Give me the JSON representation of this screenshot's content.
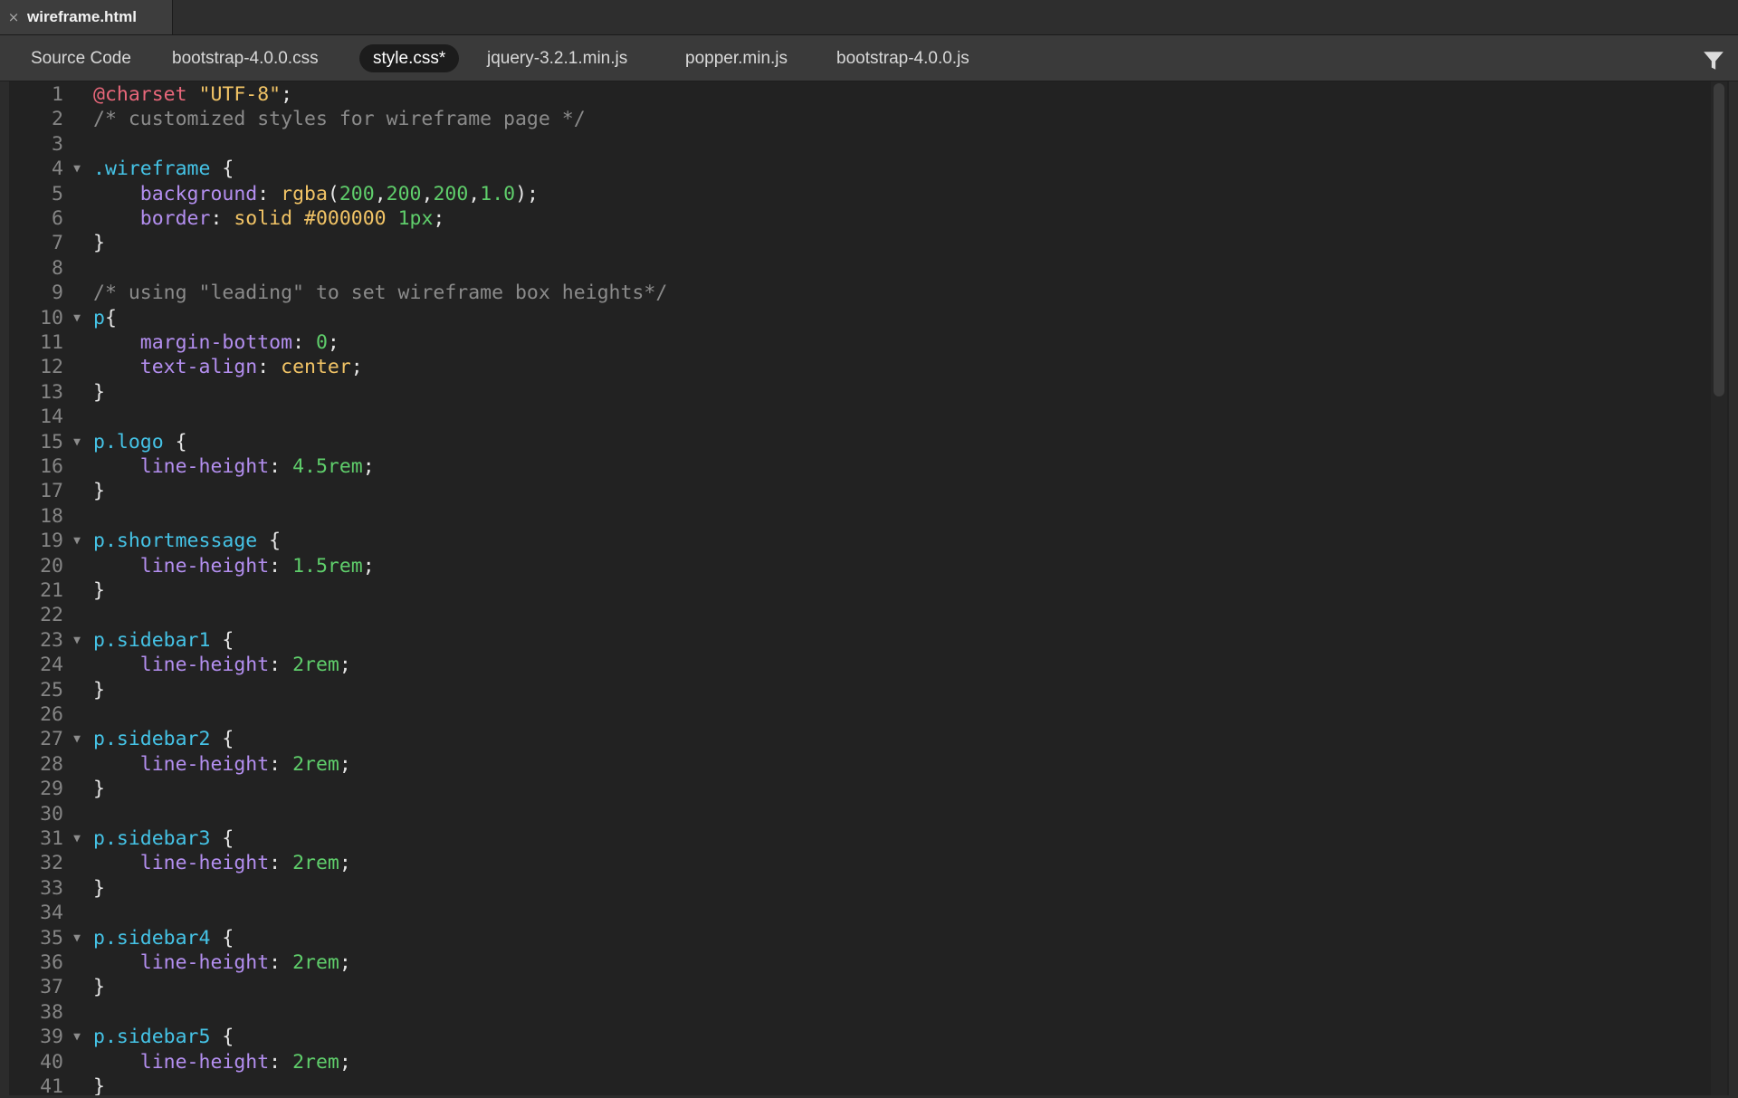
{
  "document_tab": {
    "close_glyph": "×",
    "title": "wireframe.html"
  },
  "file_tabs": [
    {
      "label": "Source Code",
      "active": false
    },
    {
      "label": "bootstrap-4.0.0.css",
      "active": false
    },
    {
      "label": "style.css*",
      "active": true
    },
    {
      "label": "jquery-3.2.1.min.js",
      "active": false
    },
    {
      "label": "popper.min.js",
      "active": false
    },
    {
      "label": "bootstrap-4.0.0.js",
      "active": false
    }
  ],
  "toolbar": {
    "filter_icon": "filter-icon"
  },
  "colors": {
    "at_rule": "#e8677a",
    "string": "#f2c466",
    "comment": "#8b8b8b",
    "selector": "#45c3e6",
    "property": "#b48ff0",
    "value": "#f2c466",
    "number": "#5fce6b"
  },
  "code_lines": [
    {
      "n": "1",
      "fold": false,
      "tokens": [
        [
          "at",
          "@charset"
        ],
        [
          "pun",
          " "
        ],
        [
          "str",
          "\"UTF-8\""
        ],
        [
          "pun",
          ";"
        ]
      ]
    },
    {
      "n": "2",
      "fold": false,
      "tokens": [
        [
          "cmt",
          "/* customized styles for wireframe page */"
        ]
      ]
    },
    {
      "n": "3",
      "fold": false,
      "tokens": []
    },
    {
      "n": "4",
      "fold": true,
      "tokens": [
        [
          "sel",
          ".wireframe"
        ],
        [
          "pun",
          " {"
        ]
      ]
    },
    {
      "n": "5",
      "fold": false,
      "tokens": [
        [
          "pun",
          "    "
        ],
        [
          "prop",
          "background"
        ],
        [
          "pun",
          ": "
        ],
        [
          "val",
          "rgba"
        ],
        [
          "pun",
          "("
        ],
        [
          "num",
          "200"
        ],
        [
          "pun",
          ","
        ],
        [
          "num",
          "200"
        ],
        [
          "pun",
          ","
        ],
        [
          "num",
          "200"
        ],
        [
          "pun",
          ","
        ],
        [
          "num",
          "1.0"
        ],
        [
          "pun",
          ");"
        ]
      ]
    },
    {
      "n": "6",
      "fold": false,
      "tokens": [
        [
          "pun",
          "    "
        ],
        [
          "prop",
          "border"
        ],
        [
          "pun",
          ": "
        ],
        [
          "val",
          "solid #000000"
        ],
        [
          "pun",
          " "
        ],
        [
          "num",
          "1px"
        ],
        [
          "pun",
          ";"
        ]
      ]
    },
    {
      "n": "7",
      "fold": false,
      "tokens": [
        [
          "pun",
          "}"
        ]
      ]
    },
    {
      "n": "8",
      "fold": false,
      "tokens": []
    },
    {
      "n": "9",
      "fold": false,
      "tokens": [
        [
          "cmt",
          "/* using \"leading\" to set wireframe box heights*/"
        ]
      ]
    },
    {
      "n": "10",
      "fold": true,
      "tokens": [
        [
          "sel",
          "p"
        ],
        [
          "pun",
          "{"
        ]
      ]
    },
    {
      "n": "11",
      "fold": false,
      "tokens": [
        [
          "pun",
          "    "
        ],
        [
          "prop",
          "margin-bottom"
        ],
        [
          "pun",
          ": "
        ],
        [
          "num",
          "0"
        ],
        [
          "pun",
          ";"
        ]
      ]
    },
    {
      "n": "12",
      "fold": false,
      "tokens": [
        [
          "pun",
          "    "
        ],
        [
          "prop",
          "text-align"
        ],
        [
          "pun",
          ": "
        ],
        [
          "val",
          "center"
        ],
        [
          "pun",
          ";"
        ]
      ]
    },
    {
      "n": "13",
      "fold": false,
      "tokens": [
        [
          "pun",
          "}"
        ]
      ]
    },
    {
      "n": "14",
      "fold": false,
      "tokens": []
    },
    {
      "n": "15",
      "fold": true,
      "tokens": [
        [
          "sel",
          "p.logo"
        ],
        [
          "pun",
          " {"
        ]
      ]
    },
    {
      "n": "16",
      "fold": false,
      "tokens": [
        [
          "pun",
          "    "
        ],
        [
          "prop",
          "line-height"
        ],
        [
          "pun",
          ": "
        ],
        [
          "num",
          "4.5rem"
        ],
        [
          "pun",
          ";"
        ]
      ]
    },
    {
      "n": "17",
      "fold": false,
      "tokens": [
        [
          "pun",
          "}"
        ]
      ]
    },
    {
      "n": "18",
      "fold": false,
      "tokens": []
    },
    {
      "n": "19",
      "fold": true,
      "tokens": [
        [
          "sel",
          "p.shortmessage"
        ],
        [
          "pun",
          " {"
        ]
      ]
    },
    {
      "n": "20",
      "fold": false,
      "tokens": [
        [
          "pun",
          "    "
        ],
        [
          "prop",
          "line-height"
        ],
        [
          "pun",
          ": "
        ],
        [
          "num",
          "1.5rem"
        ],
        [
          "pun",
          ";"
        ]
      ]
    },
    {
      "n": "21",
      "fold": false,
      "tokens": [
        [
          "pun",
          "}"
        ]
      ]
    },
    {
      "n": "22",
      "fold": false,
      "tokens": []
    },
    {
      "n": "23",
      "fold": true,
      "tokens": [
        [
          "sel",
          "p.sidebar1"
        ],
        [
          "pun",
          " {"
        ]
      ]
    },
    {
      "n": "24",
      "fold": false,
      "tokens": [
        [
          "pun",
          "    "
        ],
        [
          "prop",
          "line-height"
        ],
        [
          "pun",
          ": "
        ],
        [
          "num",
          "2rem"
        ],
        [
          "pun",
          ";"
        ]
      ]
    },
    {
      "n": "25",
      "fold": false,
      "tokens": [
        [
          "pun",
          "}"
        ]
      ]
    },
    {
      "n": "26",
      "fold": false,
      "tokens": []
    },
    {
      "n": "27",
      "fold": true,
      "tokens": [
        [
          "sel",
          "p.sidebar2"
        ],
        [
          "pun",
          " {"
        ]
      ]
    },
    {
      "n": "28",
      "fold": false,
      "tokens": [
        [
          "pun",
          "    "
        ],
        [
          "prop",
          "line-height"
        ],
        [
          "pun",
          ": "
        ],
        [
          "num",
          "2rem"
        ],
        [
          "pun",
          ";"
        ]
      ]
    },
    {
      "n": "29",
      "fold": false,
      "tokens": [
        [
          "pun",
          "}"
        ]
      ]
    },
    {
      "n": "30",
      "fold": false,
      "tokens": []
    },
    {
      "n": "31",
      "fold": true,
      "tokens": [
        [
          "sel",
          "p.sidebar3"
        ],
        [
          "pun",
          " {"
        ]
      ]
    },
    {
      "n": "32",
      "fold": false,
      "tokens": [
        [
          "pun",
          "    "
        ],
        [
          "prop",
          "line-height"
        ],
        [
          "pun",
          ": "
        ],
        [
          "num",
          "2rem"
        ],
        [
          "pun",
          ";"
        ]
      ]
    },
    {
      "n": "33",
      "fold": false,
      "tokens": [
        [
          "pun",
          "}"
        ]
      ]
    },
    {
      "n": "34",
      "fold": false,
      "tokens": []
    },
    {
      "n": "35",
      "fold": true,
      "tokens": [
        [
          "sel",
          "p.sidebar4"
        ],
        [
          "pun",
          " {"
        ]
      ]
    },
    {
      "n": "36",
      "fold": false,
      "tokens": [
        [
          "pun",
          "    "
        ],
        [
          "prop",
          "line-height"
        ],
        [
          "pun",
          ": "
        ],
        [
          "num",
          "2rem"
        ],
        [
          "pun",
          ";"
        ]
      ]
    },
    {
      "n": "37",
      "fold": false,
      "tokens": [
        [
          "pun",
          "}"
        ]
      ]
    },
    {
      "n": "38",
      "fold": false,
      "tokens": []
    },
    {
      "n": "39",
      "fold": true,
      "tokens": [
        [
          "sel",
          "p.sidebar5"
        ],
        [
          "pun",
          " {"
        ]
      ]
    },
    {
      "n": "40",
      "fold": false,
      "tokens": [
        [
          "pun",
          "    "
        ],
        [
          "prop",
          "line-height"
        ],
        [
          "pun",
          ": "
        ],
        [
          "num",
          "2rem"
        ],
        [
          "pun",
          ";"
        ]
      ]
    },
    {
      "n": "41",
      "fold": false,
      "tokens": [
        [
          "pun",
          "}"
        ]
      ]
    }
  ]
}
